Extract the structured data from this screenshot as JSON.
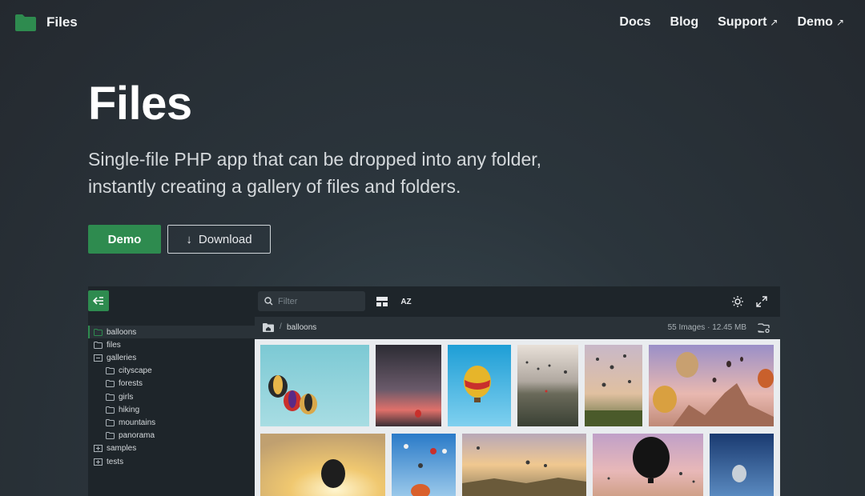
{
  "brand": {
    "name": "Files",
    "logo_icon": "folder-icon",
    "accent": "#2e8b4f"
  },
  "nav": {
    "docs": "Docs",
    "blog": "Blog",
    "support": "Support",
    "demo": "Demo",
    "external_icon": "↗"
  },
  "hero": {
    "title": "Files",
    "subtitle_line1": "Single-file PHP app that can be dropped into any folder,",
    "subtitle_line2": "instantly creating a gallery of files and folders.",
    "demo_button": "Demo",
    "download_button": "Download",
    "download_icon": "↓"
  },
  "app": {
    "filter_placeholder": "Filter",
    "sort_label": "AZ",
    "breadcrumb_sep": "/",
    "current_folder": "balloons",
    "stats": "55 Images · 12.45 MB",
    "tree": [
      {
        "label": "balloons",
        "type": "folder",
        "active": true
      },
      {
        "label": "files",
        "type": "folder"
      },
      {
        "label": "galleries",
        "type": "expanded"
      },
      {
        "label": "cityscape",
        "type": "folder"
      },
      {
        "label": "forests",
        "type": "folder"
      },
      {
        "label": "girls",
        "type": "folder"
      },
      {
        "label": "hiking",
        "type": "folder"
      },
      {
        "label": "mountains",
        "type": "folder"
      },
      {
        "label": "panorama",
        "type": "folder"
      },
      {
        "label": "samples",
        "type": "collapsed"
      },
      {
        "label": "tests",
        "type": "collapsed"
      }
    ]
  }
}
